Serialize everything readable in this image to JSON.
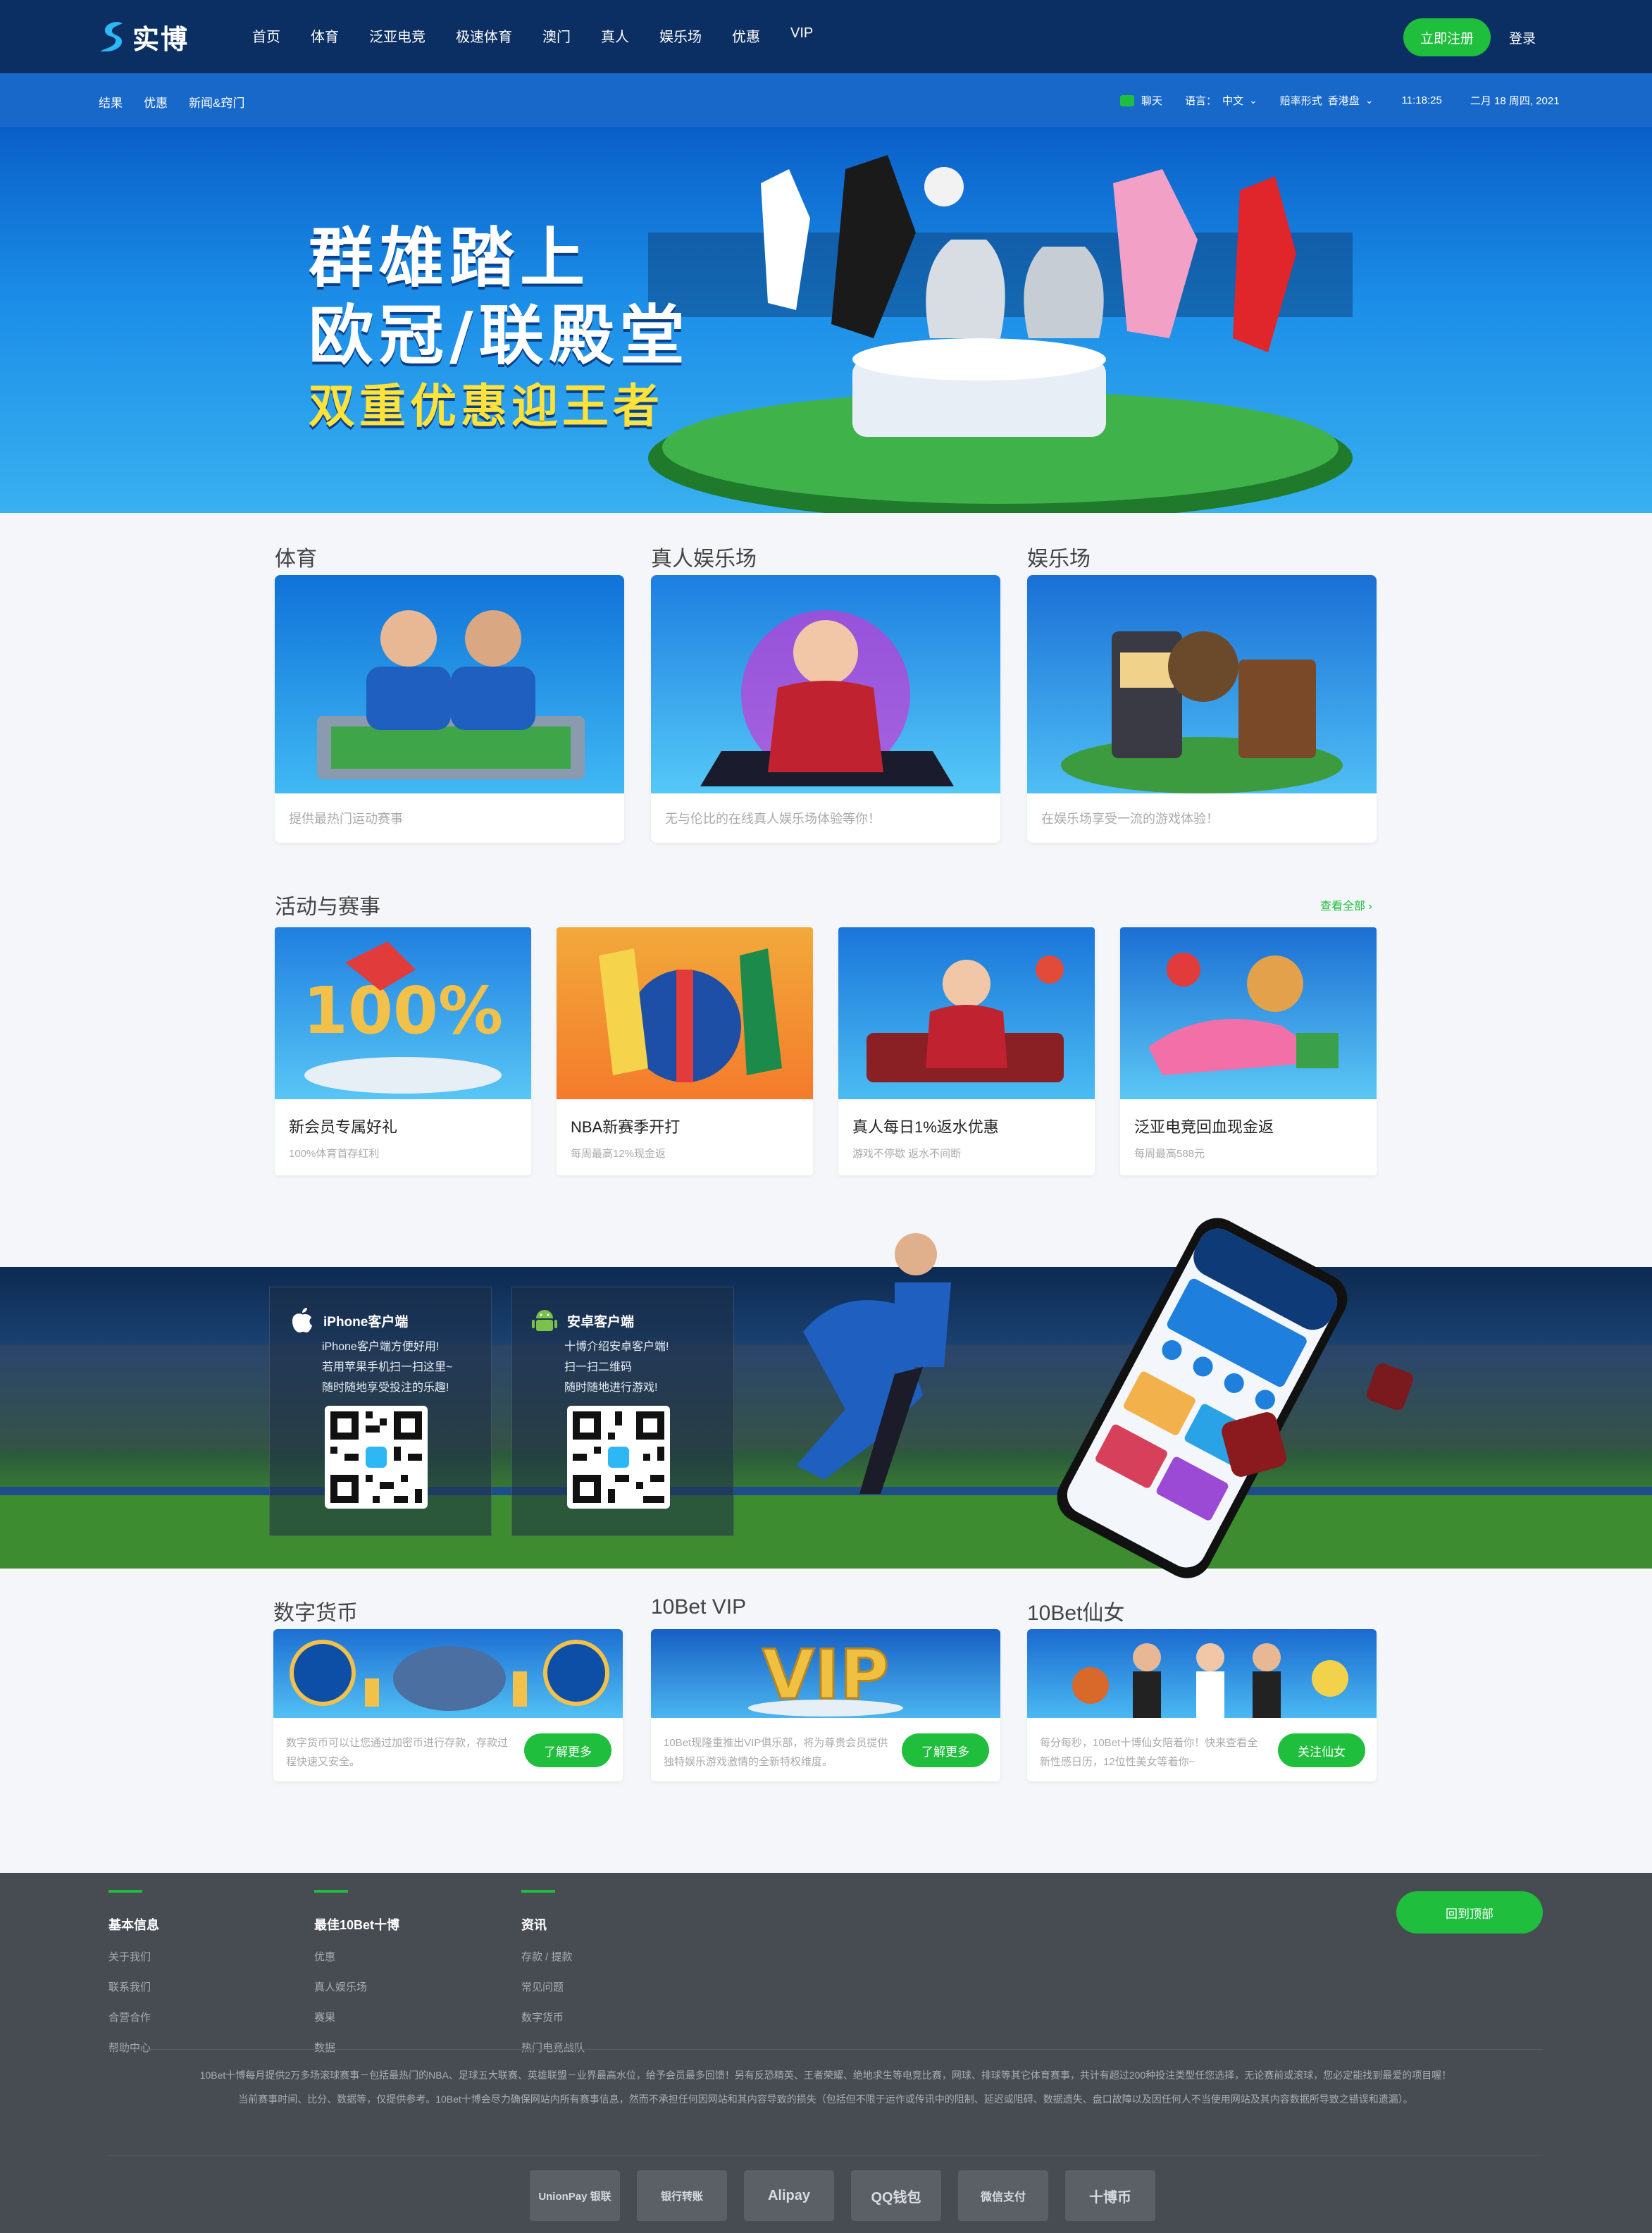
{
  "header": {
    "logo_text": "实博",
    "nav": [
      "首页",
      "体育",
      "泛亚电竞",
      "极速体育",
      "澳门",
      "真人",
      "娱乐场",
      "优惠",
      "VIP"
    ],
    "register": "立即注册",
    "login": "登录"
  },
  "subnav": {
    "left": [
      "结果",
      "优惠",
      "新闻&窍门"
    ],
    "chat": "聊天",
    "lang_label": "语言：",
    "lang_value": "中文",
    "odds_label": "赔率形式",
    "odds_value": "香港盘",
    "time": "11:18:25",
    "date": "二月 18 周四, 2021"
  },
  "hero": {
    "line1": "群雄踏上",
    "line2": "欧冠/联殿堂",
    "line3": "双重优惠迎王者"
  },
  "products": [
    {
      "title": "体育",
      "desc": "提供最热门运动赛事"
    },
    {
      "title": "真人娱乐场",
      "desc": "无与伦比的在线真人娱乐场体验等你！"
    },
    {
      "title": "娱乐场",
      "desc": "在娱乐场享受一流的游戏体验！"
    }
  ],
  "promos_section": {
    "title": "活动与赛事",
    "view_all": "查看全部"
  },
  "promos": [
    {
      "title": "新会员专属好礼",
      "sub": "100%体育首存红利",
      "badge": "100%"
    },
    {
      "title": "NBA新赛季开打",
      "sub": "每周最高12%现金返"
    },
    {
      "title": "真人每日1%返水优惠",
      "sub": "游戏不停歇 返水不间断"
    },
    {
      "title": "泛亚电竞回血现金返",
      "sub": "每周最高588元"
    }
  ],
  "apps": [
    {
      "title": "iPhone客户端",
      "lines": [
        "iPhone客户端方便好用!",
        "若用苹果手机扫一扫这里~",
        "随时随地享受投注的乐趣!"
      ]
    },
    {
      "title": "安卓客户端",
      "lines": [
        "十博介绍安卓客户端!",
        "扫一扫二维码",
        "随时随地进行游戏!"
      ]
    }
  ],
  "features": [
    {
      "title": "数字货币",
      "text": "数字货币可以让您通过加密币进行存款，存款过程快速又安全。",
      "button": "了解更多"
    },
    {
      "title": "10Bet VIP",
      "text": "10Bet现隆重推出VIP俱乐部，将为尊贵会员提供独特娱乐游戏激情的全新特权维度。",
      "button": "了解更多",
      "badge": "VIP"
    },
    {
      "title": "10Bet仙女",
      "text": "每分每秒，10Bet十博仙女陪着你！快来查看全新性感日历，12位性美女等着你~",
      "button": "关注仙女"
    }
  ],
  "footer": {
    "columns": [
      {
        "title": "基本信息",
        "items": [
          "关于我们",
          "联系我们",
          "合营合作",
          "帮助中心"
        ]
      },
      {
        "title": "最佳10Bet十博",
        "items": [
          "优惠",
          "真人娱乐场",
          "赛果",
          "数据"
        ]
      },
      {
        "title": "资讯",
        "items": [
          "存款 / 提款",
          "常见问题",
          "数字货币",
          "热门电竞战队"
        ]
      }
    ],
    "back_top": "回到顶部",
    "para1": "10Bet十博每月提供2万多场滚球赛事－包括最热门的NBA、足球五大联赛、英雄联盟－业界最高水位，给予会员最多回馈！另有反恐精英、王者荣耀、绝地求生等电竞比赛，网球、排球等其它体育赛事，共计有超过200种投注类型任您选择，无论赛前或滚球，您必定能找到最爱的项目喔！",
    "para2": "当前赛事时间、比分、数据等，仅提供参考。10Bet十博会尽力确保网站内所有赛事信息，然而不承担任何因网站和其内容导致的损失（包括但不限于运作或传讯中的阻制、延迟或阻碍、数据遗失、盘口故障以及因任何人不当使用网站及其内容数据所导致之错误和遗漏）。",
    "payments": [
      "UnionPay 银联",
      "银行转账",
      "Alipay",
      "QQ钱包",
      "微信支付",
      "十博币"
    ]
  },
  "colors": {
    "nav_bg": "#0b2e63",
    "subnav_bg": "#1768c9",
    "accent_green": "#1fbf3d",
    "footer_bg": "#474b52"
  }
}
